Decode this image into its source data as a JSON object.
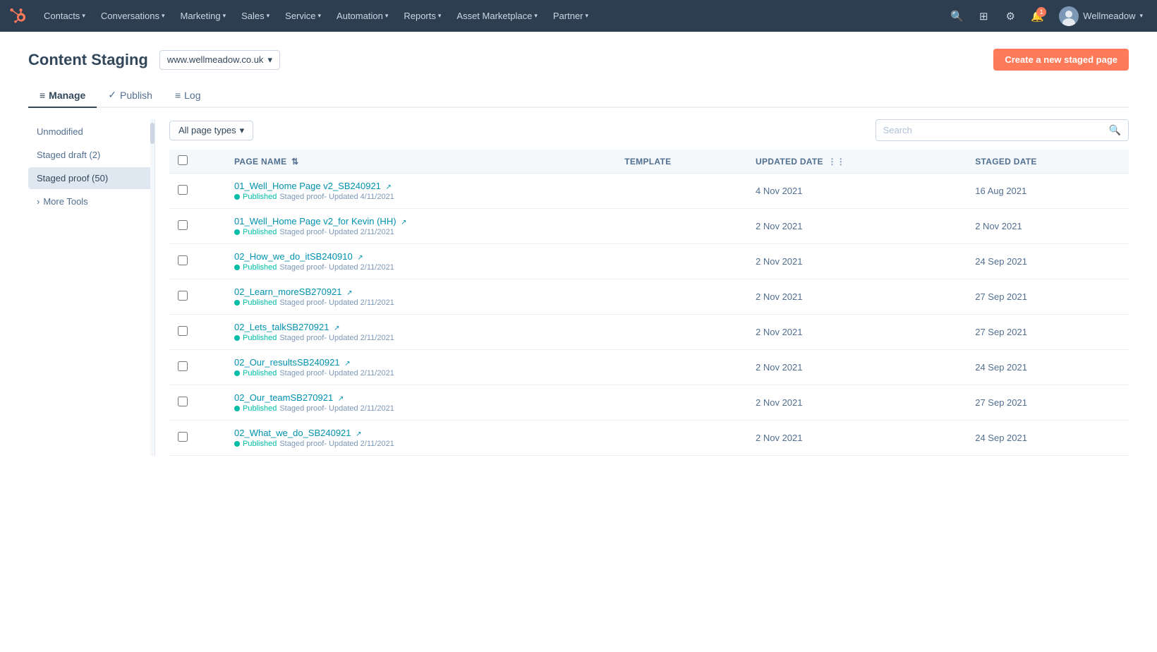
{
  "nav": {
    "logo_alt": "HubSpot",
    "items": [
      {
        "label": "Contacts",
        "has_dropdown": true
      },
      {
        "label": "Conversations",
        "has_dropdown": true
      },
      {
        "label": "Marketing",
        "has_dropdown": true
      },
      {
        "label": "Sales",
        "has_dropdown": true
      },
      {
        "label": "Service",
        "has_dropdown": true
      },
      {
        "label": "Automation",
        "has_dropdown": true
      },
      {
        "label": "Reports",
        "has_dropdown": true
      },
      {
        "label": "Asset Marketplace",
        "has_dropdown": true
      },
      {
        "label": "Partner",
        "has_dropdown": true
      }
    ],
    "user": "Wellmeadow",
    "notification_count": "1"
  },
  "header": {
    "title": "Content Staging",
    "domain": "www.wellmeadow.co.uk",
    "create_btn_label": "Create a new staged page"
  },
  "tabs": [
    {
      "id": "manage",
      "label": "Manage",
      "icon": "≡",
      "active": true
    },
    {
      "id": "publish",
      "label": "Publish",
      "icon": "✓",
      "active": false
    },
    {
      "id": "log",
      "label": "Log",
      "icon": "≡",
      "active": false
    }
  ],
  "sidebar": {
    "items": [
      {
        "label": "Unmodified",
        "active": false,
        "count": null
      },
      {
        "label": "Staged draft (2)",
        "active": false,
        "count": null
      },
      {
        "label": "Staged proof (50)",
        "active": true,
        "count": null
      }
    ],
    "more_tools_label": "More Tools"
  },
  "table": {
    "filter_label": "All page types",
    "search_placeholder": "Search",
    "columns": [
      {
        "key": "name",
        "label": "PAGE NAME",
        "sortable": true
      },
      {
        "key": "template",
        "label": "TEMPLATE",
        "sortable": false
      },
      {
        "key": "updated_date",
        "label": "UPDATED DATE",
        "sortable": true
      },
      {
        "key": "staged_date",
        "label": "STAGED DATE",
        "sortable": false
      }
    ],
    "rows": [
      {
        "id": 1,
        "name": "01_Well_Home Page v2_SB240921",
        "status": "Published",
        "staged_info": "Staged proof- Updated 4/11/2021",
        "template": "",
        "updated_date": "4 Nov 2021",
        "staged_date": "16 Aug 2021"
      },
      {
        "id": 2,
        "name": "01_Well_Home Page v2_for Kevin (HH)",
        "status": "Published",
        "staged_info": "Staged proof- Updated 2/11/2021",
        "template": "",
        "updated_date": "2 Nov 2021",
        "staged_date": "2 Nov 2021"
      },
      {
        "id": 3,
        "name": "02_How_we_do_itSB240910",
        "status": "Published",
        "staged_info": "Staged proof- Updated 2/11/2021",
        "template": "",
        "updated_date": "2 Nov 2021",
        "staged_date": "24 Sep 2021"
      },
      {
        "id": 4,
        "name": "02_Learn_moreSB270921",
        "status": "Published",
        "staged_info": "Staged proof- Updated 2/11/2021",
        "template": "",
        "updated_date": "2 Nov 2021",
        "staged_date": "27 Sep 2021"
      },
      {
        "id": 5,
        "name": "02_Lets_talkSB270921",
        "status": "Published",
        "staged_info": "Staged proof- Updated 2/11/2021",
        "template": "",
        "updated_date": "2 Nov 2021",
        "staged_date": "27 Sep 2021"
      },
      {
        "id": 6,
        "name": "02_Our_resultsSB240921",
        "status": "Published",
        "staged_info": "Staged proof- Updated 2/11/2021",
        "template": "",
        "updated_date": "2 Nov 2021",
        "staged_date": "24 Sep 2021"
      },
      {
        "id": 7,
        "name": "02_Our_teamSB270921",
        "status": "Published",
        "staged_info": "Staged proof- Updated 2/11/2021",
        "template": "",
        "updated_date": "2 Nov 2021",
        "staged_date": "27 Sep 2021"
      },
      {
        "id": 8,
        "name": "02_What_we_do_SB240921",
        "status": "Published",
        "staged_info": "Staged proof- Updated 2/11/2021",
        "template": "",
        "updated_date": "2 Nov 2021",
        "staged_date": "24 Sep 2021"
      }
    ]
  }
}
